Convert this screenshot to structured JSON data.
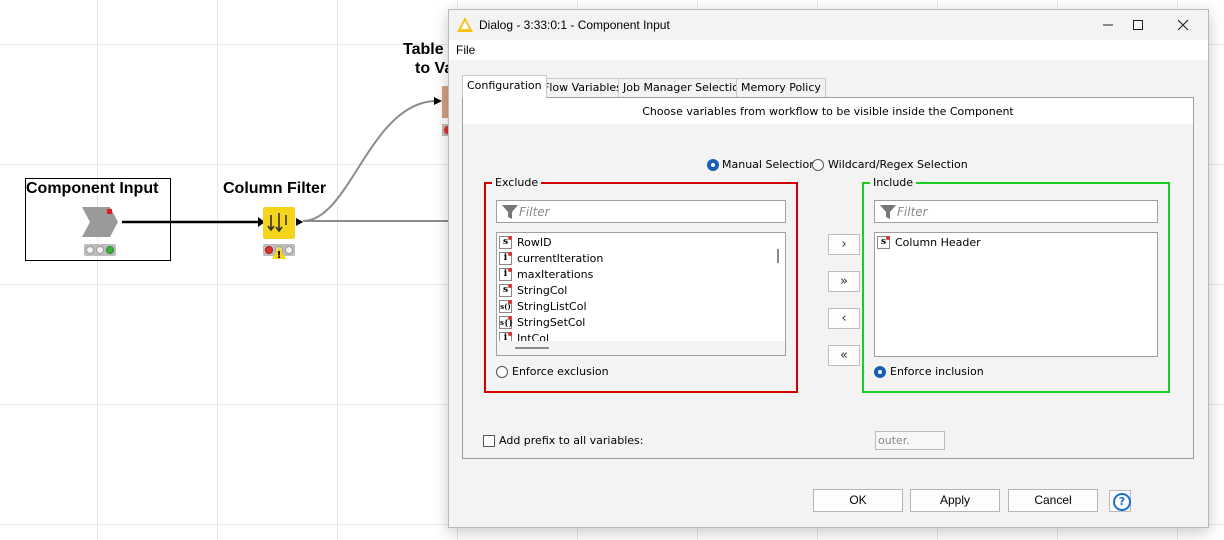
{
  "workflow": {
    "nodes": {
      "component_input": {
        "title": "Component Input"
      },
      "column_filter": {
        "title": "Column Filter"
      },
      "table_to_var": {
        "title_line1": "Table (",
        "title_line2": "to Va"
      }
    }
  },
  "dialog": {
    "title": "Dialog - 3:33:0:1 - Component Input",
    "menu": {
      "file": "File"
    },
    "tabs": [
      {
        "label": "Configuration",
        "active": true
      },
      {
        "label": "Flow Variables",
        "active": false
      },
      {
        "label": "Job Manager Selection",
        "active": false
      },
      {
        "label": "Memory Policy",
        "active": false
      }
    ],
    "description": "Choose variables from workflow to be visible inside the Component",
    "selection_mode": {
      "manual": "Manual Selection",
      "wildcard": "Wildcard/Regex Selection",
      "selected": "manual"
    },
    "exclude": {
      "legend": "Exclude",
      "filter_placeholder": "Filter",
      "items": [
        {
          "type": "s",
          "name": "RowID"
        },
        {
          "type": "i",
          "name": "currentIteration"
        },
        {
          "type": "i",
          "name": "maxIterations"
        },
        {
          "type": "s",
          "name": "StringCol"
        },
        {
          "type": "s()",
          "name": "StringListCol"
        },
        {
          "type": "s{}",
          "name": "StringSetCol"
        },
        {
          "type": "i",
          "name": "IntCol"
        }
      ],
      "enforce_label": "Enforce exclusion",
      "enforce_selected": false
    },
    "include": {
      "legend": "Include",
      "filter_placeholder": "Filter",
      "items": [
        {
          "type": "s",
          "name": "Column Header"
        }
      ],
      "enforce_label": "Enforce inclusion",
      "enforce_selected": true
    },
    "shuttle_buttons": {
      "add": "›",
      "add_all": "»",
      "remove": "‹",
      "remove_all": "«"
    },
    "prefix": {
      "label": "Add prefix to all variables:",
      "checked": false,
      "value": "outer."
    },
    "buttons": {
      "ok": "OK",
      "apply": "Apply",
      "cancel": "Cancel",
      "help": "?"
    },
    "colors": {
      "exclude_border": "#d00000",
      "include_border": "#1ccc1c",
      "accent": "#1a5fb4"
    }
  }
}
